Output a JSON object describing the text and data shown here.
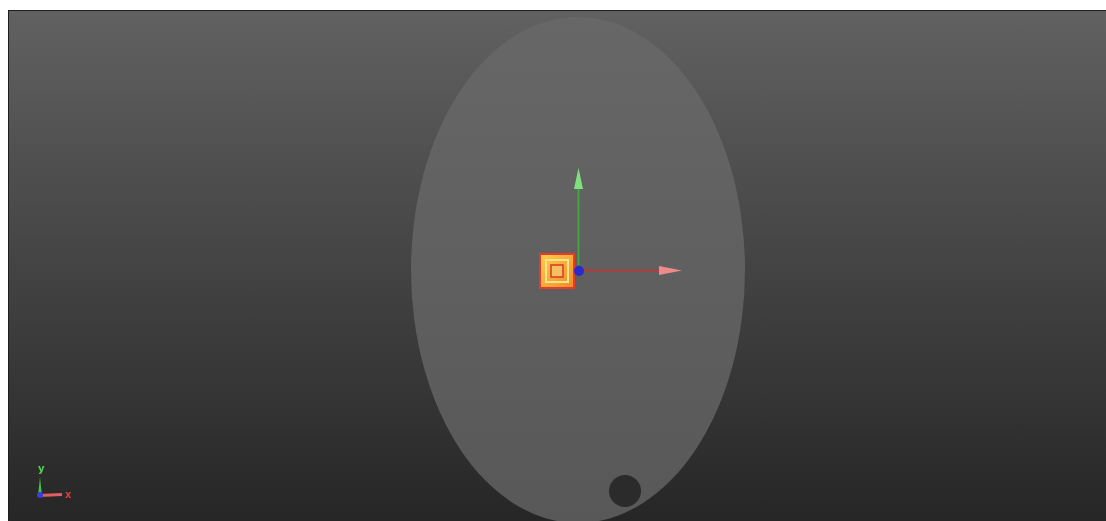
{
  "axis_triad": {
    "y_label": "y",
    "x_label": "x"
  }
}
